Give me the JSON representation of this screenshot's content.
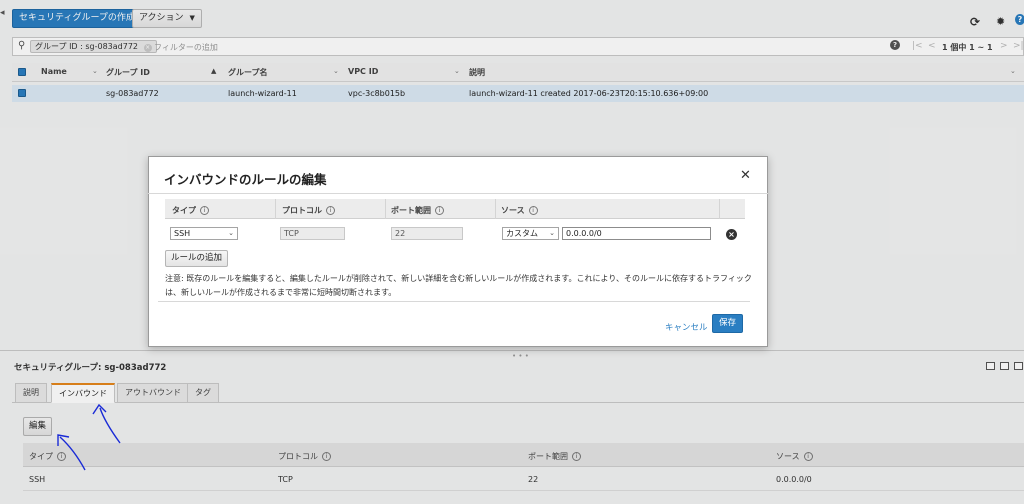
{
  "toolbar": {
    "create_label": "セキュリティグループの作成",
    "actions_label": "アクション"
  },
  "filter": {
    "chip_label": "グループ ID : sg-083ad772",
    "placeholder": "フィルターの追加",
    "pagination": "1 個中 1 ~ 1"
  },
  "table": {
    "headers": [
      "Name",
      "グループ ID",
      "グループ名",
      "VPC ID",
      "説明"
    ],
    "row": {
      "name": "",
      "group_id": "sg-083ad772",
      "group_name": "launch-wizard-11",
      "vpc_id": "vpc-3c8b015b",
      "description": "launch-wizard-11 created 2017-06-23T20:15:10.636+09:00"
    }
  },
  "modal": {
    "title": "インバウンドのルールの編集",
    "columns": [
      "タイプ",
      "プロトコル",
      "ポート範囲",
      "ソース"
    ],
    "rule": {
      "type": "SSH",
      "protocol": "TCP",
      "port_range": "22",
      "source_type": "カスタム",
      "source_value": "0.0.0.0/0"
    },
    "add_rule_label": "ルールの追加",
    "note_line1": "注意: 既存のルールを編集すると、編集したルールが削除されて、新しい詳細を含む新しいルールが作成されます。これにより、そのルールに依存するトラフィック",
    "note_line2": "は、新しいルールが作成されるまで非常に短時間切断されます。",
    "cancel_label": "キャンセル",
    "save_label": "保存"
  },
  "detail": {
    "title": "セキュリティグループ: sg-083ad772",
    "tabs": [
      "説明",
      "インバウンド",
      "アウトバウンド",
      "タグ"
    ],
    "edit_label": "編集",
    "columns": [
      "タイプ",
      "プロトコル",
      "ポート範囲",
      "ソース"
    ],
    "row": {
      "type": "SSH",
      "protocol": "TCP",
      "port_range": "22",
      "source": "0.0.0.0/0"
    }
  },
  "colors": {
    "primary": "#2a7ec2",
    "selected_row": "#dbe9f5",
    "active_tab_accent": "#e5861b",
    "annotation": "#1a2bd6"
  }
}
